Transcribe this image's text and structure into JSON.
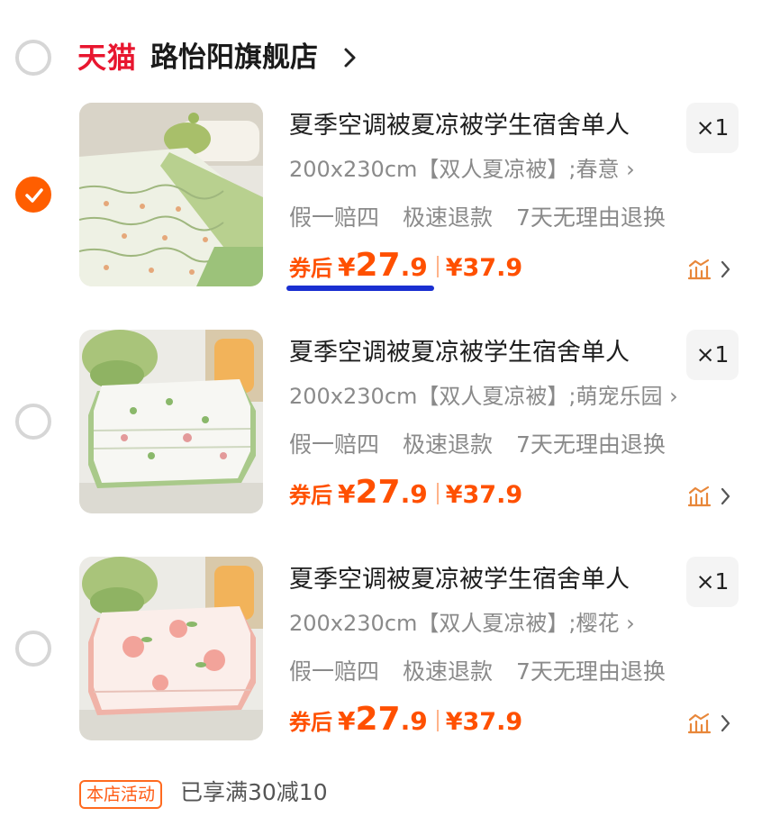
{
  "store": {
    "logo_text": "天猫",
    "name": "路怡阳旗舰店",
    "chevron": "›"
  },
  "items": [
    {
      "title": "夏季空调被夏凉被学生宿舍单人",
      "qty": "×1",
      "sku": "200x230cm【双人夏凉被】;春意",
      "sku_arrow": "›",
      "services": [
        "假一赔四",
        "极速退款",
        "7天无理由退换"
      ],
      "coupon_label": "券后",
      "yen": "¥",
      "price_int": "27",
      "price_dec": ".9",
      "orig_price": "¥37.9",
      "selected": true
    },
    {
      "title": "夏季空调被夏凉被学生宿舍单人",
      "qty": "×1",
      "sku": "200x230cm【双人夏凉被】;萌宠乐园",
      "sku_arrow": "›",
      "services": [
        "假一赔四",
        "极速退款",
        "7天无理由退换"
      ],
      "coupon_label": "券后",
      "yen": "¥",
      "price_int": "27",
      "price_dec": ".9",
      "orig_price": "¥37.9",
      "selected": false
    },
    {
      "title": "夏季空调被夏凉被学生宿舍单人",
      "qty": "×1",
      "sku": "200x230cm【双人夏凉被】;樱花",
      "sku_arrow": "›",
      "services": [
        "假一赔四",
        "极速退款",
        "7天无理由退换"
      ],
      "coupon_label": "券后",
      "yen": "¥",
      "price_int": "27",
      "price_dec": ".9",
      "orig_price": "¥37.9",
      "selected": false
    }
  ],
  "footer": {
    "badge": "本店活动",
    "text": "已享满30减10"
  },
  "colors": {
    "accent": "#ff5000",
    "tmall_red": "#e8162f",
    "annotation_underline": "#1a2fd1"
  },
  "icons": [
    "checkmark-icon",
    "chevron-right-icon",
    "price-trend-icon"
  ]
}
